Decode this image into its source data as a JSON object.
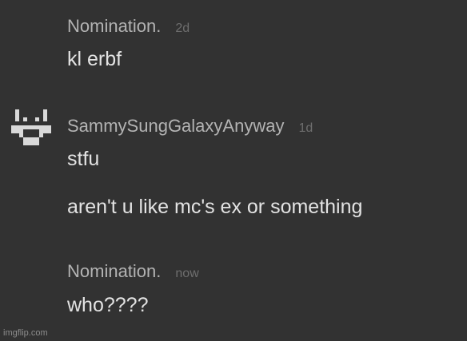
{
  "comments": [
    {
      "author": "Nomination.",
      "time": "2d",
      "lines": [
        "kl erbf"
      ]
    },
    {
      "author": "SammySungGalaxyAnyway",
      "time": "1d",
      "avatar_icon": "pixel-avatar-icon",
      "lines": [
        "stfu",
        "aren't u like mc's ex or something"
      ]
    },
    {
      "author": "Nomination.",
      "time": "now",
      "lines": [
        "who????"
      ]
    }
  ],
  "watermark": "imgflip.com",
  "colors": {
    "background": "#323232",
    "author": "#b3b3b3",
    "timestamp": "#6e6e6e",
    "text": "#e3e3e3",
    "avatar": "#d9d9d9"
  }
}
